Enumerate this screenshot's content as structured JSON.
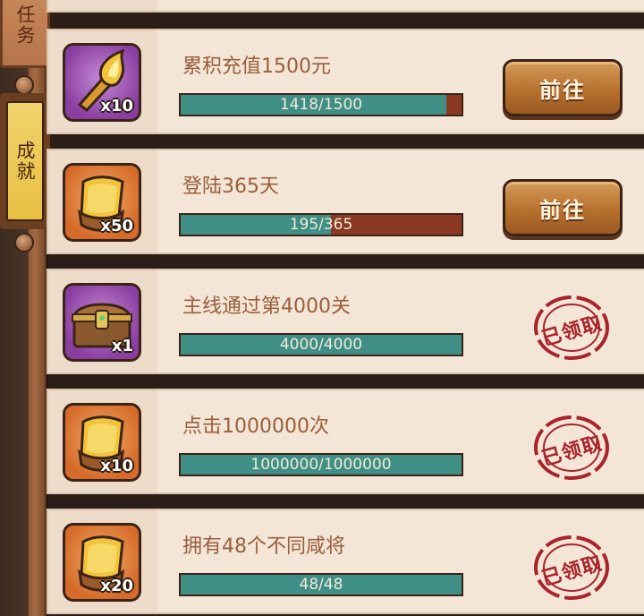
{
  "sidebar": {
    "tabs": [
      {
        "label": "任务",
        "active": false
      },
      {
        "label": "成就",
        "active": true
      }
    ]
  },
  "achievements": [
    {
      "title": "累积充值1500元",
      "reward_icon": "golden-torch-icon",
      "reward_bg": "purple",
      "quantity": "x10",
      "progress_text": "1418/1500",
      "progress": 0.945,
      "status": "go",
      "button_label": "前往"
    },
    {
      "title": "登陆365天",
      "reward_icon": "gold-scroll-icon",
      "reward_bg": "orange",
      "quantity": "x50",
      "progress_text": "195/365",
      "progress": 0.534,
      "status": "go",
      "button_label": "前往"
    },
    {
      "title": "主线通过第4000关",
      "reward_icon": "treasure-chest-icon",
      "reward_bg": "purple",
      "quantity": "x1",
      "progress_text": "4000/4000",
      "progress": 1.0,
      "status": "claimed",
      "stamp_label": "已领取"
    },
    {
      "title": "点击1000000次",
      "reward_icon": "gold-scroll-icon",
      "reward_bg": "orange",
      "quantity": "x10",
      "progress_text": "1000000/1000000",
      "progress": 1.0,
      "status": "claimed",
      "stamp_label": "已领取"
    },
    {
      "title": "拥有48个不同咸将",
      "reward_icon": "gold-scroll-icon",
      "reward_bg": "orange",
      "quantity": "x20",
      "progress_text": "48/48",
      "progress": 1.0,
      "status": "claimed",
      "stamp_label": "已领取"
    }
  ],
  "colors": {
    "card_bg": "#f3e6d6",
    "progress_fill": "#3f8f86",
    "progress_track": "#8a3a24",
    "title_text": "#9a5e3c",
    "stamp_red": "#a8232a",
    "active_tab": "#e7bf43"
  }
}
